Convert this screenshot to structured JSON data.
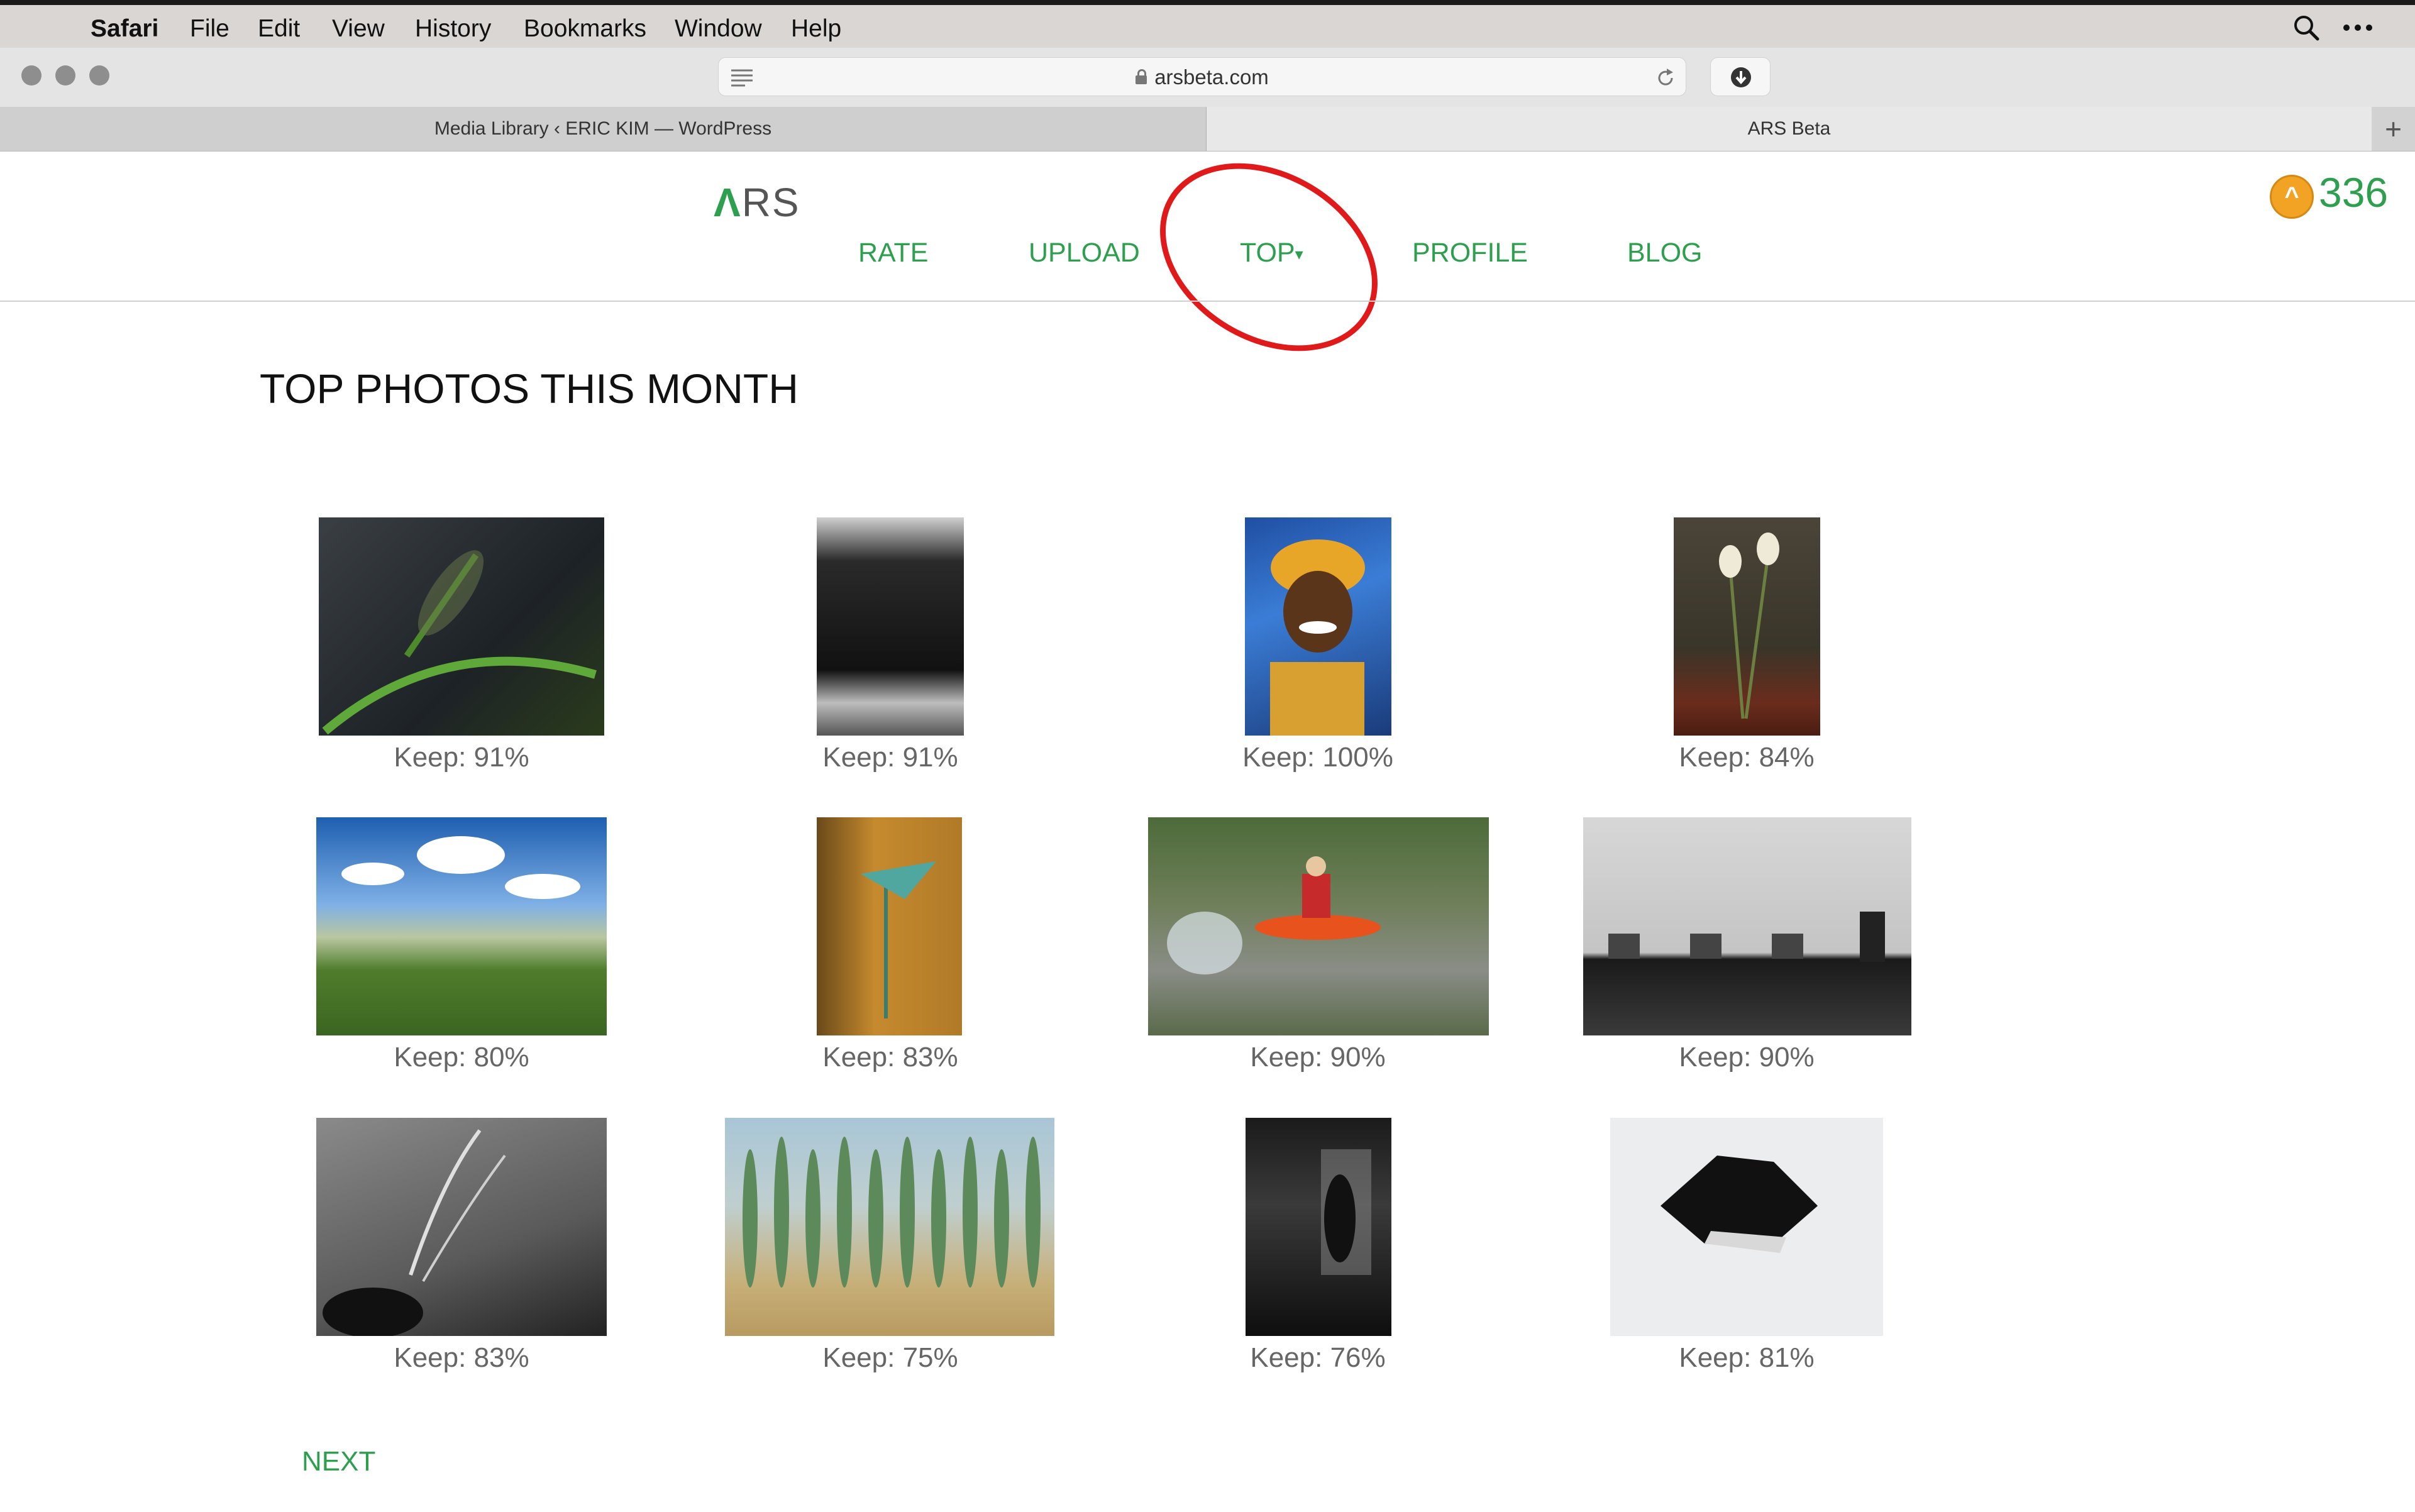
{
  "menubar": {
    "app": "Safari",
    "items": [
      "File",
      "Edit",
      "View",
      "History",
      "Bookmarks",
      "Window",
      "Help"
    ]
  },
  "browser": {
    "url": "arsbeta.com",
    "tabs": [
      "Media Library ‹ ERIC KIM — WordPress",
      "ARS Beta"
    ],
    "new_tab": "+"
  },
  "site": {
    "logo_mark": "Λ",
    "logo_text": "RS",
    "nav": [
      "RATE",
      "UPLOAD",
      "TOP",
      "PROFILE",
      "BLOG"
    ],
    "top_caret": "▾",
    "score": "336",
    "colors": {
      "accent": "#2e9e4f",
      "annotation": "#e0191b",
      "coin": "#f2a324"
    }
  },
  "main": {
    "title": "TOP PHOTOS THIS MONTH",
    "photos": [
      {
        "caption": "Keep: 91%",
        "subject": "dragonfly on leaf"
      },
      {
        "caption": "Keep: 91%",
        "subject": "Tate Modern building"
      },
      {
        "caption": "Keep: 100%",
        "subject": "smiling woman with headwrap"
      },
      {
        "caption": "Keep: 84%",
        "subject": "calla lilies in vase"
      },
      {
        "caption": "Keep: 80%",
        "subject": "landscape with clouds"
      },
      {
        "caption": "Keep: 83%",
        "subject": "calla lily against wall"
      },
      {
        "caption": "Keep: 90%",
        "subject": "kayaker splashing"
      },
      {
        "caption": "Keep: 90%",
        "subject": "chairs and seated person"
      },
      {
        "caption": "Keep: 83%",
        "subject": "hand with smoke"
      },
      {
        "caption": "Keep: 75%",
        "subject": "row of cypress trees"
      },
      {
        "caption": "Keep: 76%",
        "subject": "figure in dark doorway"
      },
      {
        "caption": "Keep: 81%",
        "subject": "torn paper hole"
      }
    ],
    "next_label": "NEXT"
  }
}
